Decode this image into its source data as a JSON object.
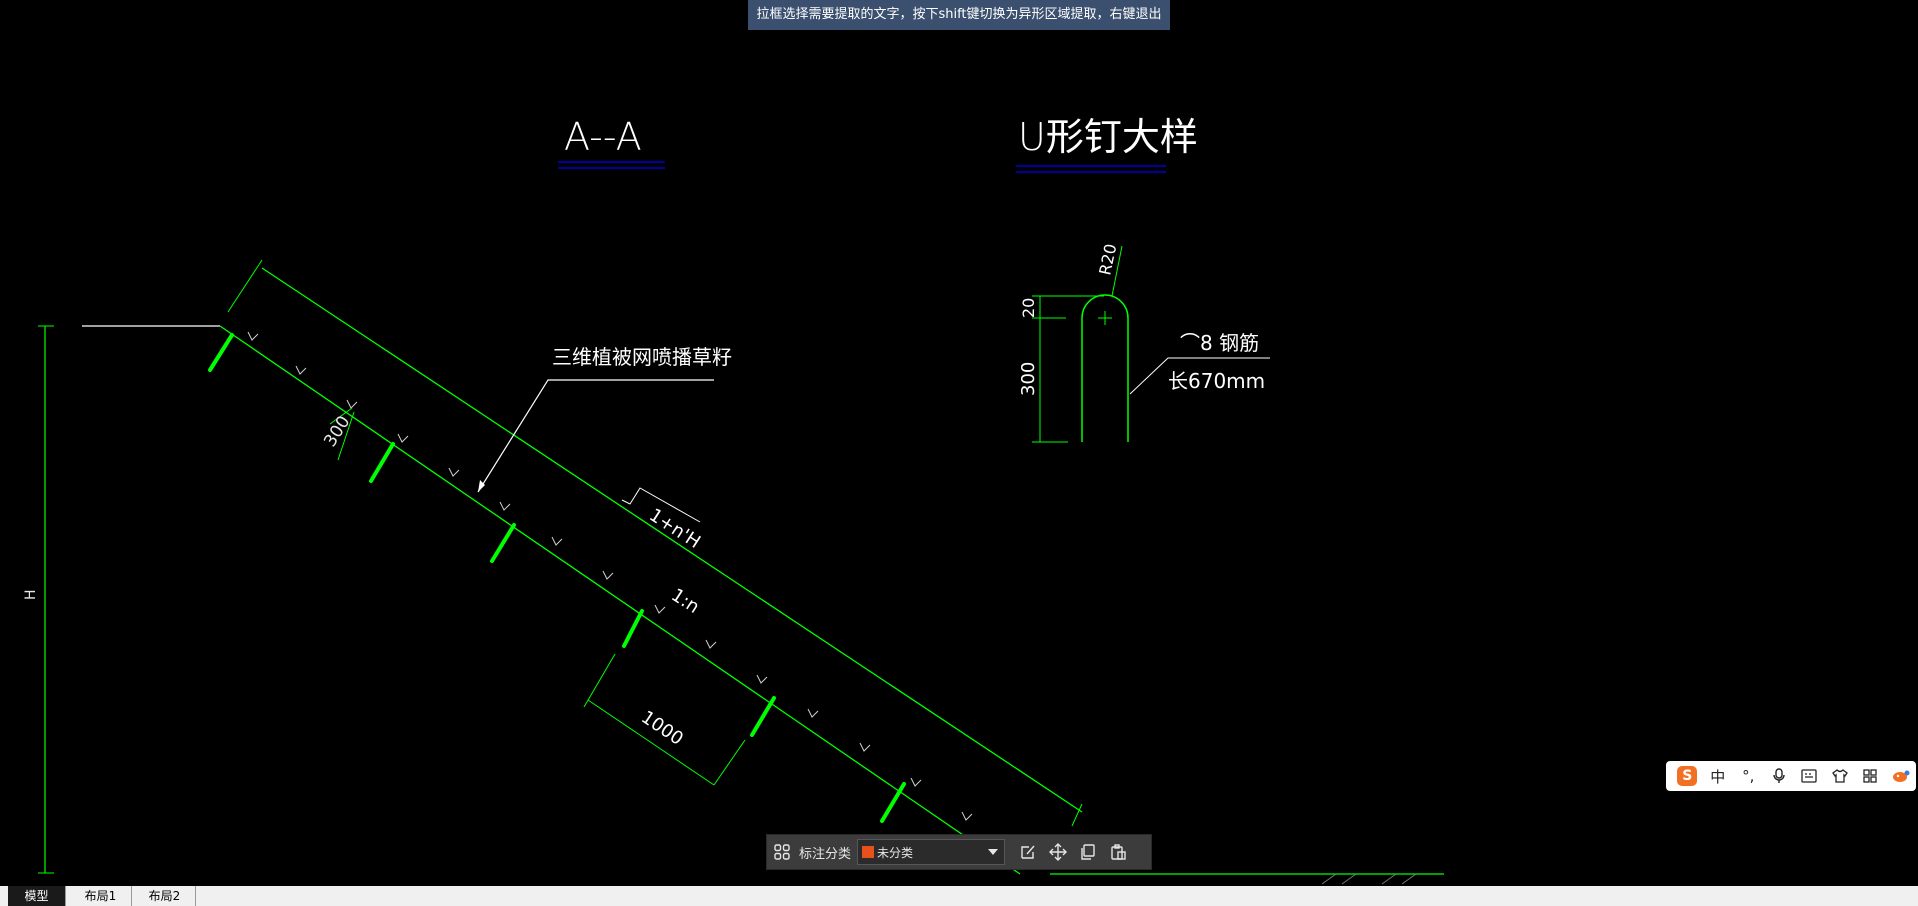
{
  "hint": "拉框选择需要提取的文字，按下shift键切换为异形区域提取，右键退出",
  "drawing": {
    "title_left": "A--A",
    "title_right": "U形钉大样",
    "label_net": "三维植被网喷播草籽",
    "dim_300_slope": "300",
    "slope_ratio": "1:n",
    "slope_length": "1+n'H",
    "dim_1000": "1000",
    "height_label": "H",
    "radius_label": "R20",
    "dim_20": "20",
    "dim_300": "300",
    "rebar_label": "⌒8 钢筋",
    "length_label": "长670mm"
  },
  "toolbar": {
    "grid_icon": "grid-icon",
    "label": "标注分类",
    "category_value": "未分类",
    "category_color": "#e8501c",
    "edit_icon": "edit-icon",
    "move_icon": "move-icon",
    "copy_icon": "copy-icon",
    "paste_icon": "paste-icon"
  },
  "ime": {
    "logo": "S",
    "lang": "中",
    "punct": "°,",
    "icons": [
      "mic-icon",
      "keyboard-icon",
      "shirt-icon",
      "apps-icon",
      "mascot-icon"
    ]
  },
  "tabs": [
    {
      "label": "模型",
      "active": true
    },
    {
      "label": "布局1",
      "active": false
    },
    {
      "label": "布局2",
      "active": false
    }
  ],
  "colors": {
    "line_green": "#00ff00",
    "line_white": "#ffffff",
    "title_blue": "#0000ff"
  }
}
